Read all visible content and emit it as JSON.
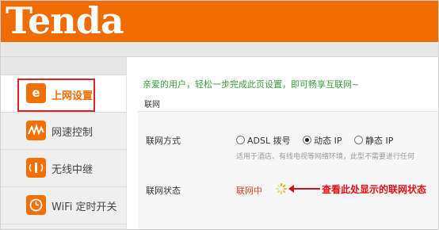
{
  "header": {
    "logo_text": "Tenda",
    "brand_color": "#ef6c00"
  },
  "sidebar": {
    "items": [
      {
        "label": "上网设置",
        "icon": "ie-icon",
        "active": true
      },
      {
        "label": "网速控制",
        "icon": "speed-wave-icon",
        "active": false
      },
      {
        "label": "无线中继",
        "icon": "wireless-relay-icon",
        "active": false
      },
      {
        "label": "WiFi 定时开关",
        "icon": "clock-icon",
        "active": false
      }
    ]
  },
  "main": {
    "welcome": "亲爱的用户，轻松一步完成此页设置，即可畅享互联网~",
    "section_title": "联网",
    "connection_type": {
      "label": "联网方式",
      "options": [
        {
          "label": "ADSL 拨号",
          "checked": false
        },
        {
          "label": "动态 IP",
          "checked": true
        },
        {
          "label": "静态 IP",
          "checked": false
        }
      ],
      "hint": "适用于酒店、有线电视等网络环境，此型不需要进行任何"
    },
    "connection_status": {
      "label": "联网状态",
      "value": "联网中",
      "annotation": "查看此处显示的联网状态"
    }
  },
  "colors": {
    "accent": "#ef6c00",
    "welcome_text": "#3a9c3a",
    "status_text": "#e04020",
    "annotation_red": "#e01010"
  }
}
